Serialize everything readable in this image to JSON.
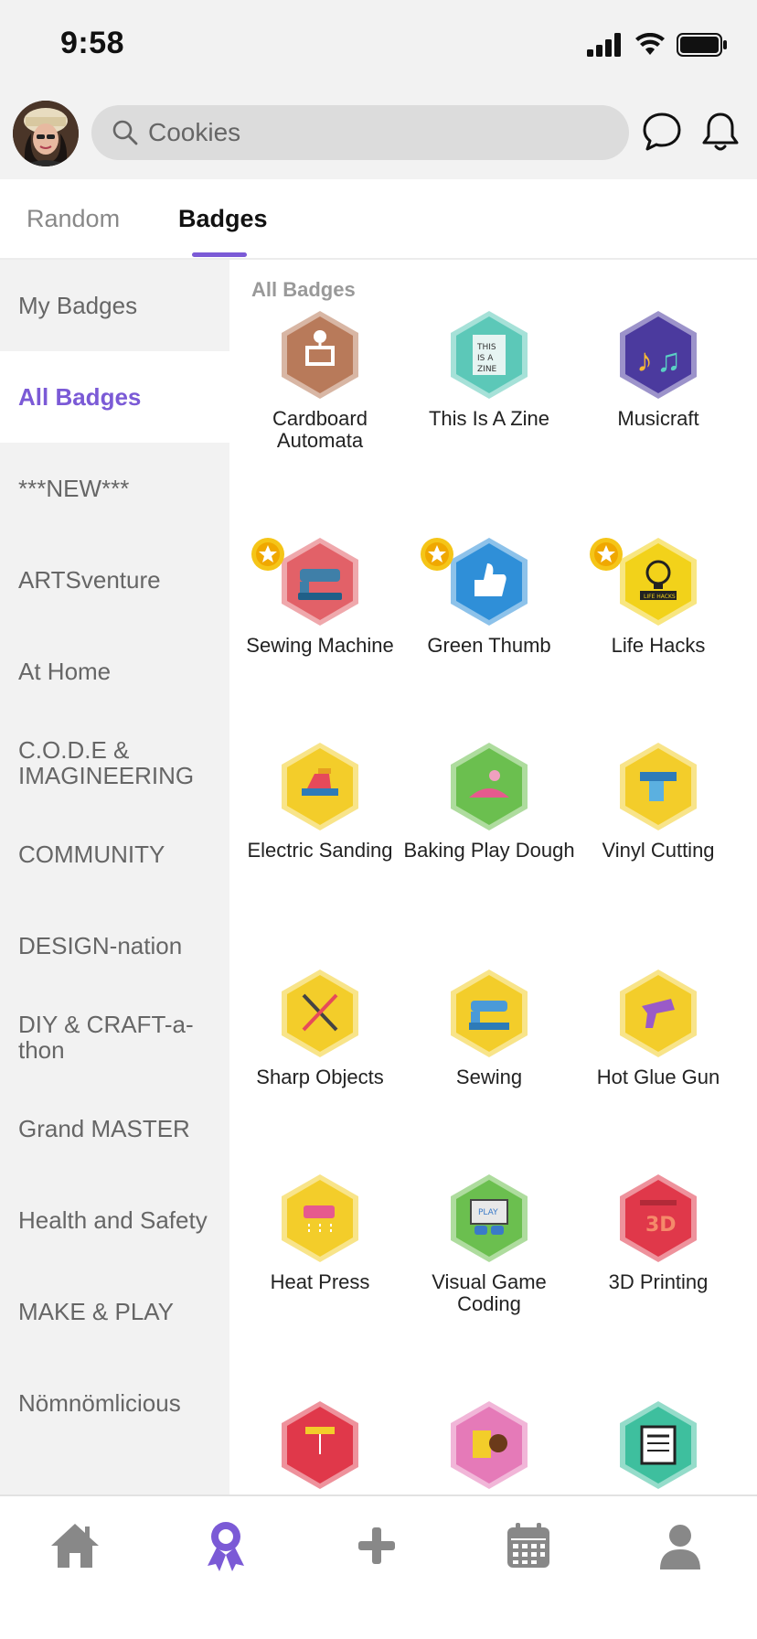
{
  "status": {
    "time": "9:58",
    "icons": [
      "signal-icon",
      "wifi-icon",
      "battery-icon"
    ]
  },
  "header": {
    "search_value": "Cookies",
    "icons": [
      "search-icon",
      "chat-icon",
      "bell-icon"
    ]
  },
  "tabs": [
    {
      "label": "Random",
      "active": false
    },
    {
      "label": "Badges",
      "active": true
    }
  ],
  "sidebar": {
    "items": [
      {
        "label": "My Badges"
      },
      {
        "label": "All Badges",
        "active": true
      },
      {
        "label": "***NEW***"
      },
      {
        "label": "ARTSventure"
      },
      {
        "label": "At Home"
      },
      {
        "label": "C.O.D.E & IMAGINEERING"
      },
      {
        "label": "COMMUNITY"
      },
      {
        "label": "DESIGN-nation"
      },
      {
        "label": "DIY & CRAFT-a-thon"
      },
      {
        "label": "Grand MASTER"
      },
      {
        "label": "Health and Safety"
      },
      {
        "label": "MAKE & PLAY"
      },
      {
        "label": "Nömnömlicious"
      }
    ]
  },
  "main": {
    "section_title": "All Badges",
    "badges": [
      {
        "label": "Cardboard Automata",
        "color": "#b87a5a",
        "icon": "automata-icon",
        "starred": false
      },
      {
        "label": "This Is A Zine",
        "color": "#5cc8b8",
        "icon": "zine-icon",
        "starred": false
      },
      {
        "label": "Musicraft",
        "color": "#4b3a9e",
        "icon": "music-notes-icon",
        "starred": false
      },
      {
        "label": "Sewing Machine",
        "color": "#e26168",
        "icon": "sewing-machine-icon",
        "starred": true
      },
      {
        "label": "Green Thumb",
        "color": "#2f8fd8",
        "icon": "thumbs-up-icon",
        "starred": true
      },
      {
        "label": "Life Hacks",
        "color": "#f2d21a",
        "icon": "lightbulb-icon",
        "starred": true
      },
      {
        "label": "Electric Sanding",
        "color": "#f3cd2a",
        "icon": "sander-icon",
        "starred": false
      },
      {
        "label": "Baking Play Dough",
        "color": "#6bbf4f",
        "icon": "play-dough-icon",
        "starred": false
      },
      {
        "label": "Vinyl Cutting",
        "color": "#f3cd2a",
        "icon": "vinyl-cutter-icon",
        "starred": false
      },
      {
        "label": "Sharp Objects",
        "color": "#f3cd2a",
        "icon": "scissors-icon",
        "starred": false
      },
      {
        "label": "Sewing",
        "color": "#f3cd2a",
        "icon": "sewing-icon",
        "starred": false
      },
      {
        "label": "Hot Glue Gun",
        "color": "#f3cd2a",
        "icon": "glue-gun-icon",
        "starred": false
      },
      {
        "label": "Heat Press",
        "color": "#f3cd2a",
        "icon": "heat-press-icon",
        "starred": false
      },
      {
        "label": "Visual Game Coding",
        "color": "#6bbf4f",
        "icon": "game-screen-icon",
        "starred": false
      },
      {
        "label": "3D Printing",
        "color": "#e0384a",
        "icon": "3d-printer-icon",
        "starred": false
      },
      {
        "label": "",
        "color": "#e0384a",
        "icon": "laser-icon",
        "starred": false
      },
      {
        "label": "",
        "color": "#e57ab8",
        "icon": "design-tools-icon",
        "starred": false
      },
      {
        "label": "",
        "color": "#3ebf9e",
        "icon": "newspaper-icon",
        "starred": false
      }
    ]
  },
  "bottom_nav": [
    {
      "icon": "home-icon",
      "active": false
    },
    {
      "icon": "badge-ribbon-icon",
      "active": true
    },
    {
      "icon": "plus-icon",
      "active": false
    },
    {
      "icon": "calendar-icon",
      "active": false
    },
    {
      "icon": "profile-icon",
      "active": false
    }
  ],
  "colors": {
    "accent": "#7b5ad6",
    "inactive_icon": "#888888",
    "sidebar_bg": "#f2f2f2"
  }
}
